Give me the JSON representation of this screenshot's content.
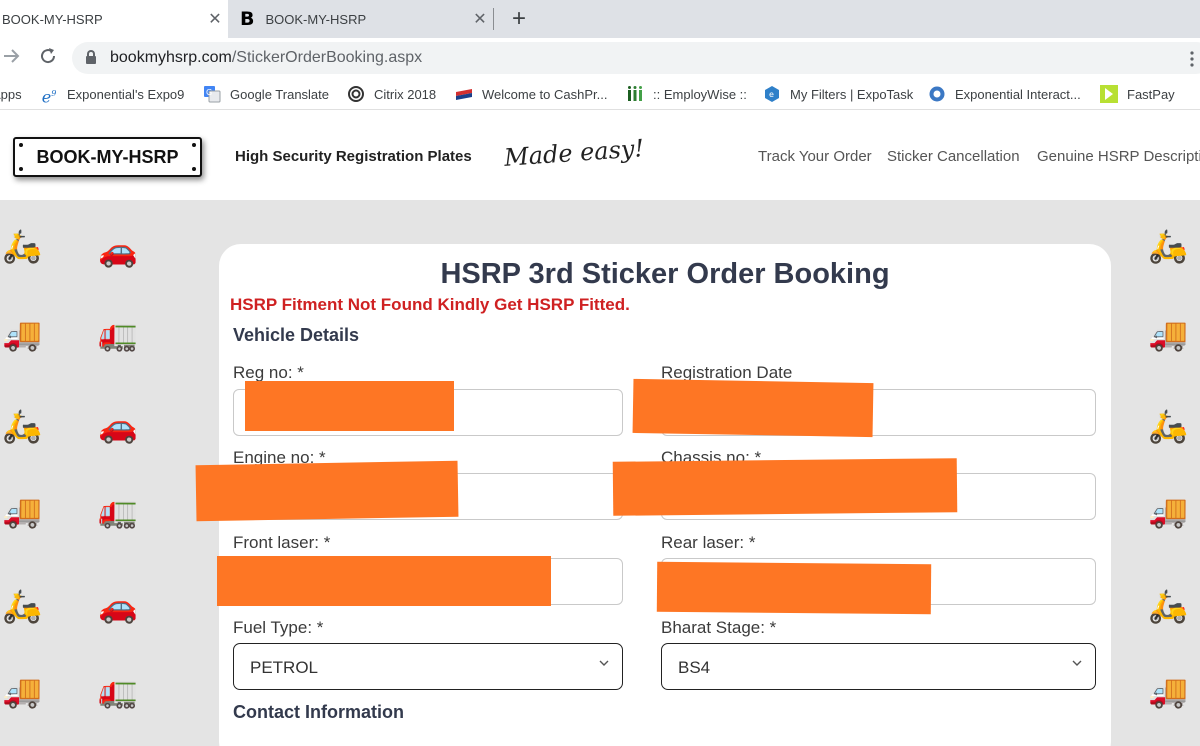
{
  "browser": {
    "tabs": [
      {
        "title": "BOOK-MY-HSRP",
        "close": "✕"
      },
      {
        "favicon": "B",
        "title": "BOOK-MY-HSRP",
        "close": "✕"
      }
    ],
    "new_tab": "+",
    "url_host": "bookmyhsrp.com",
    "url_path": "/StickerOrderBooking.aspx",
    "bookmarks": [
      {
        "label": "Apps",
        "icon": "apps-grid-icon"
      },
      {
        "label": "Exponential's Expo9",
        "icon": "e9-icon"
      },
      {
        "label": "Google Translate",
        "icon": "translate-icon"
      },
      {
        "label": "Citrix 2018",
        "icon": "citrix-icon"
      },
      {
        "label": "Welcome to CashPr...",
        "icon": "flag-icon"
      },
      {
        "label": ":: EmployWise ::",
        "icon": "bars-icon"
      },
      {
        "label": "My Filters | ExpoTask",
        "icon": "expotask-icon"
      },
      {
        "label": "Exponential Interact...",
        "icon": "circle-icon"
      },
      {
        "label": "FastPay",
        "icon": "arrow-icon"
      }
    ]
  },
  "site": {
    "logo": "BOOK-MY-HSRP",
    "tagline": "High Security Registration Plates",
    "slogan": "Made easy!",
    "nav": [
      "Track Your Order",
      "Sticker Cancellation",
      "Genuine HSRP Descripti"
    ]
  },
  "form": {
    "title": "HSRP 3rd Sticker Order Booking",
    "error": "HSRP Fitment Not Found Kindly Get HSRP Fitted.",
    "vehicle_section": "Vehicle Details",
    "reg_no_label": "Reg no: *",
    "reg_date_label": "Registration Date",
    "engine_no_label": "Engine no: *",
    "chassis_no_label": "Chassis no: *",
    "front_laser_label": "Front laser: *",
    "rear_laser_label": "Rear laser: *",
    "fuel_type_label": "Fuel Type: *",
    "fuel_type_value": "PETROL",
    "bharat_stage_label": "Bharat Stage: *",
    "bharat_stage_value": "BS4",
    "contact_section": "Contact Information"
  },
  "colors": {
    "error": "#cf2122",
    "heading": "#333a4d",
    "redaction": "#fe7624",
    "page_background": "#e4e4e4"
  }
}
